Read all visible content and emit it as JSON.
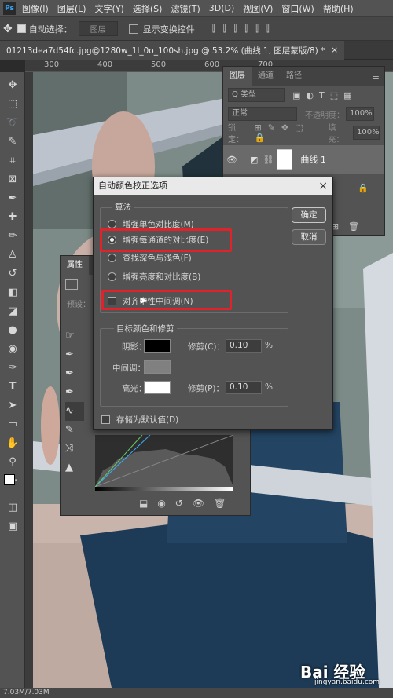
{
  "menubar": {
    "app_icon": "Ps",
    "items": [
      "图像(I)",
      "图层(L)",
      "文字(Y)",
      "选择(S)",
      "滤镜(T)",
      "3D(D)",
      "视图(V)",
      "窗口(W)",
      "帮助(H)"
    ]
  },
  "options": {
    "auto_select_label": "自动选择：",
    "auto_select_value": "图层",
    "show_transform_label": "显示变换控件"
  },
  "document": {
    "tab_title": "01213dea7d54fc.jpg@1280w_1l_0o_100sh.jpg @ 53.2% (曲线 1, 图层蒙版/8) *",
    "close": "×"
  },
  "ruler": {
    "ticks": [
      "300",
      "400",
      "500",
      "600",
      "700"
    ]
  },
  "status": {
    "doc_size": "7.03M/7.03M"
  },
  "layers_panel": {
    "tabs": [
      "图层",
      "通道",
      "路径"
    ],
    "filter_label": "Q 类型",
    "blend_mode": "正常",
    "opacity_label": "不透明度：",
    "opacity_value": "100%",
    "lock_label": "锁定：",
    "fill_label": "填充：",
    "fill_value": "100%",
    "layer_name": "曲线 1"
  },
  "properties_panel": {
    "tab": "属性",
    "preset_label": "预设："
  },
  "dialog": {
    "title": "自动颜色校正选项",
    "close": "×",
    "algorithm_group": "算法",
    "options": [
      {
        "label": "增强单色对比度(M)",
        "selected": false
      },
      {
        "label": "增强每通道的对比度(E)",
        "selected": true
      },
      {
        "label": "查找深色与浅色(F)",
        "selected": false
      },
      {
        "label": "增强亮度和对比度(B)",
        "selected": false
      }
    ],
    "snap_neutral_label": "对齐中性中间调(N)",
    "snap_neutral_checked": false,
    "ok_label": "确定",
    "cancel_label": "取消",
    "target_group": "目标颜色和修剪",
    "shadows_label": "阴影：",
    "midtones_label": "中间调：",
    "highlights_label": "高光：",
    "shadow_clip_label": "修剪(C)：",
    "shadow_clip_value": "0.10",
    "highlight_clip_label": "修剪(P)：",
    "highlight_clip_value": "0.10",
    "percent": "%",
    "save_default_label": "存储为默认值(D)",
    "save_default_checked": false,
    "shadow_color": "#000000",
    "midtone_color": "#808080",
    "highlight_color": "#ffffff"
  },
  "watermark": {
    "text": "Bai 经验",
    "sub": "jingyan.baidu.com"
  }
}
